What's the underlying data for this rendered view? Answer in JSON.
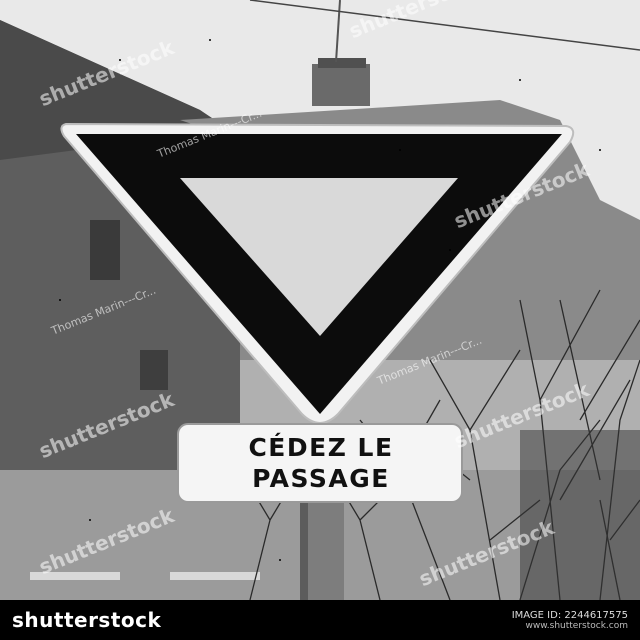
{
  "photo": {
    "subject": "yield-sign",
    "style": "black-and-white"
  },
  "sign_plate": {
    "line1": "CÉDEZ LE",
    "line2": "PASSAGE"
  },
  "watermarks": {
    "stock": "shutterstock",
    "author": "Thomas Marin---Cr..."
  },
  "footer": {
    "brand": "shutterstock",
    "image_id": "IMAGE ID: 2244617575",
    "url": "www.shutterstock.com"
  }
}
